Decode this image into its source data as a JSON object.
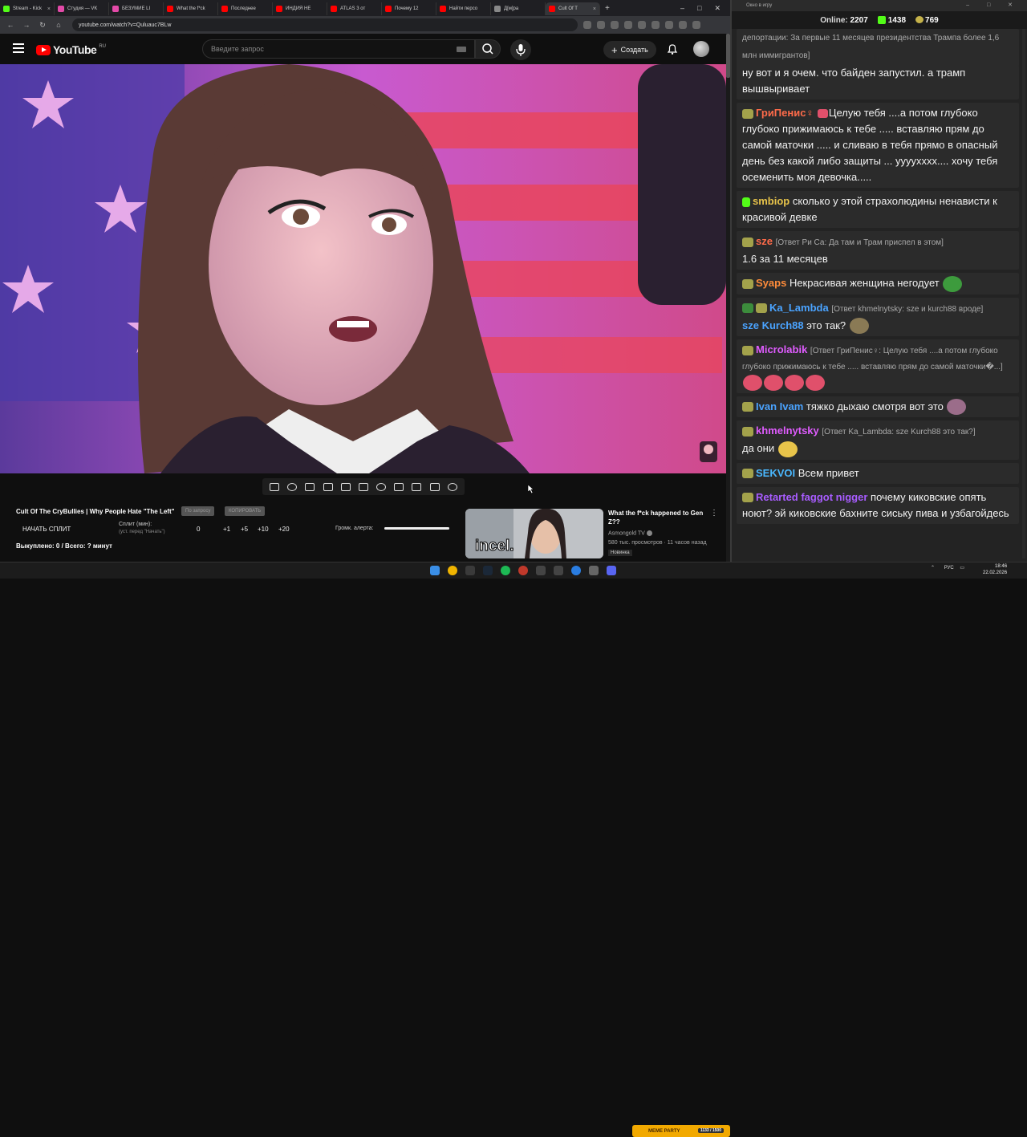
{
  "browser": {
    "tabs": [
      {
        "label": "Stream - Kick"
      },
      {
        "label": "Студия — VK"
      },
      {
        "label": "БЕЗУМИЕ LI"
      },
      {
        "label": "What the f*ck"
      },
      {
        "label": "Последнее"
      },
      {
        "label": "ИНДИЯ НЕ"
      },
      {
        "label": "ATLAS 3 от"
      },
      {
        "label": "Почему 12"
      },
      {
        "label": "Найти персо"
      },
      {
        "label": "Д[м]рa"
      },
      {
        "label": "Cult Of T"
      }
    ],
    "url": "youtube.com/watch?v=Quluauc7BLw"
  },
  "youtube": {
    "logo_text": "YouTube",
    "logo_region": "RU",
    "search_placeholder": "Введите запрос",
    "create_label": "Создать"
  },
  "video": {
    "title": "Cult Of The CryBullies | Why People Hate \"The Left\"",
    "btn_start_split": "НАЧАТЬ СПЛИТ",
    "btn_copy_link": "По запросу",
    "btn_copy": "КОПИРОВАТЬ",
    "split_label": "Сплит (мин):",
    "split_hint": "(уст. перед \"Начать\")",
    "split_value": "0",
    "steps": [
      "+1",
      "+5",
      "+10",
      "+20"
    ],
    "alert_volume_label": "Громк. алерта:",
    "alert_volume": 1.0,
    "stats": "Выкуплено: 0 / Всего: ? минут"
  },
  "recommendation": {
    "thumb_caption": "incel.",
    "title": "What the f*ck happened to Gen Z??",
    "channel": "Asmongold TV",
    "views": "580 тыс. просмотров · 11 часов назад",
    "badge": "Новинка"
  },
  "chat": {
    "window_title": "Окно в игру",
    "online_label": "Online:",
    "online_count": "2207",
    "kick_count": "1438",
    "coin_count": "769",
    "messages": [
      {
        "user": "",
        "text": "депортации: За первые 11 месяцев президентства Трампа более 1,6 млн иммигрантов]",
        "color": "#aaaaaa"
      },
      {
        "user": "",
        "text": "ну вот и я очем. что байден запустил. а трамп вышвыривает",
        "color": "#ffffff"
      },
      {
        "user": "ГриПенис♀",
        "text": "Целую тебя ....а потом глубоко  глубоко прижимаюсь к тебе ..... вставляю прям до самой маточки ..... и сливаю в тебя  прямо в опасный день  без какой либо защиты ... ууууxxxx....  хочу тебя  осеменить моя девочка.....",
        "color": "#ff6b4a"
      },
      {
        "user": "smbiop",
        "text": "сколько у этой страхолюдины ненависти к красивой девке",
        "color": "#e8c44a"
      },
      {
        "user": "sze",
        "reply": "[Ответ Ри Са: Да там и Трам приспел в этом]",
        "text": "1.6 за 11 месяцев",
        "color": "#ff6b4a"
      },
      {
        "user": "Syaps",
        "text": "Некрасивая женщина негодует",
        "color": "#ff8c3a"
      },
      {
        "user": "Ka_Lambda",
        "reply": "[Ответ khmelnytsky: sze и  kurch88 вроде]",
        "text": "sze Kurch88 это так?",
        "color": "#4aa3ff"
      },
      {
        "user": "Microlabik",
        "reply": "[Ответ ГриПенис♀: Целую тебя ....а потом глубоко  глубоко прижимаюсь к тебе ..... вставляю прям до самой маточки�...]",
        "text": "",
        "color": "#e05cff"
      },
      {
        "user": "Ivan Ivam",
        "text": "тяжко дыхаю смотря вот это",
        "color": "#4aa3ff"
      },
      {
        "user": "khmelnytsky",
        "reply": "[Ответ Ka_Lambda: sze Kurch88 это так?]",
        "text": "да они",
        "color": "#e05cff"
      },
      {
        "user": "SEKVOI",
        "text": "Всем привет",
        "color": "#4ab8ff"
      },
      {
        "user": "Retarted faggot nigger",
        "text": "почему киковские опять ноют? эй киковские бахните сиську пива и узбагойдесь",
        "color": "#a85cff"
      }
    ]
  },
  "taskbar": {
    "lang": "РУС",
    "time": "18:46",
    "date": "22.02.2026",
    "meme_party_label": "MEME PARTY",
    "meme_party_value": "1133 / 1500"
  },
  "colors": {
    "youtube_red": "#ff0000",
    "kick_green": "#53fc18",
    "chat_bg": "#232323"
  }
}
